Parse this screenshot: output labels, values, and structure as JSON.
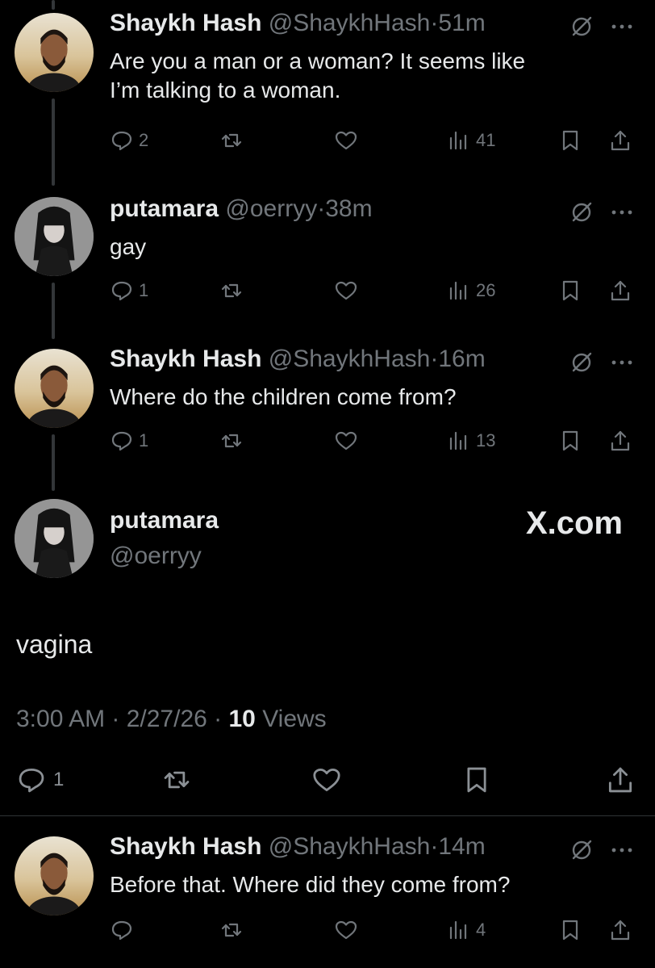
{
  "tweets": [
    {
      "name": "Shaykh Hash",
      "handle": "@ShaykhHash",
      "sep": "·",
      "time": "51m",
      "text_lines": [
        "Are you a man or a woman? It seems like",
        "I’m talking to a woman."
      ],
      "replies": "2",
      "views": "41"
    },
    {
      "name": "putamara",
      "handle": "@oerryy",
      "sep": "·",
      "time": "38m",
      "text_lines": [
        "gay"
      ],
      "replies": "1",
      "views": "26"
    },
    {
      "name": "Shaykh Hash",
      "handle": "@ShaykhHash",
      "sep": "·",
      "time": "16m",
      "text_lines": [
        "Where do the children come from?"
      ],
      "replies": "1",
      "views": "13"
    },
    {
      "name": "Shaykh Hash",
      "handle": "@ShaykhHash",
      "sep": "·",
      "time": "14m",
      "text_lines": [
        "Before that. Where did they come from?"
      ],
      "replies": "",
      "views": "4"
    }
  ],
  "focused": {
    "name": "putamara",
    "handle": "@oerryy",
    "watermark": "X.com",
    "text": "vagina",
    "timestamp": "3:00 AM · 2/27/26 · ",
    "views_count": "10",
    "views_label": " Views",
    "replies": "1"
  },
  "icons": [
    "reply-icon",
    "repost-icon",
    "like-icon",
    "views-icon",
    "bookmark-icon",
    "share-icon",
    "grok-icon",
    "more-icon"
  ],
  "colors": {
    "background": "#000000",
    "text": "#e7e9ea",
    "muted": "#71767b"
  }
}
